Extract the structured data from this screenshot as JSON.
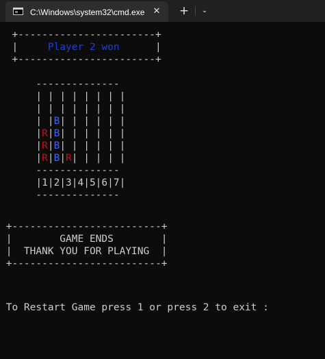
{
  "window": {
    "tab_title": "C:\\Windows\\system32\\cmd.exe",
    "tab_icon": "cmd-icon",
    "close_glyph": "✕",
    "new_tab_glyph": "+",
    "dropdown_glyph": "⌄"
  },
  "terminal": {
    "colors": {
      "background": "#0c0c0c",
      "text": "#cccccc",
      "winner_text": "#1f3fd8",
      "red_piece": "#c50f1f",
      "blue_piece": "#3a66ff"
    },
    "winner_box": {
      "top": "  +-----------------------+",
      "middle_left": "  |     ",
      "message": "Player 2 won",
      "middle_right": "      |",
      "bottom": "  +-----------------------+"
    },
    "board": {
      "top_border": "      --------------",
      "rows": [
        [
          "",
          "",
          "",
          "",
          "",
          "",
          ""
        ],
        [
          "",
          "",
          "",
          "",
          "",
          "",
          ""
        ],
        [
          "",
          "B",
          "",
          "",
          "",
          "",
          ""
        ],
        [
          "R",
          "B",
          "",
          "",
          "",
          "",
          ""
        ],
        [
          "R",
          "B",
          "",
          "",
          "",
          "",
          ""
        ],
        [
          "R",
          "B",
          "R",
          "",
          "",
          "",
          ""
        ]
      ],
      "mid_border": "      --------------",
      "column_numbers": "      |1|2|3|4|5|6|7|",
      "bottom_border": "      --------------"
    },
    "game_ends_box": {
      "top": " +-------------------------+",
      "line1": " |        GAME ENDS        |",
      "line2": " |  THANK YOU FOR PLAYING  |",
      "bottom": " +-------------------------+"
    },
    "prompt": " To Restart Game press 1 or press 2 to exit :"
  }
}
